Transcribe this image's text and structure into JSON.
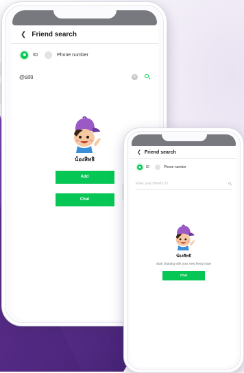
{
  "big_phone": {
    "header_title": "Friend search",
    "radio_id_label": "ID",
    "radio_phone_label": "Phone number",
    "search_value": "@sitti",
    "profile_name": "น้องสิทธิ",
    "add_label": "Add",
    "chat_label": "Chat"
  },
  "small_phone": {
    "header_title": "Friend search",
    "radio_id_label": "ID",
    "radio_phone_label": "Phone number",
    "search_placeholder": "Enter your friend's ID",
    "profile_name": "น้องสิทธิ",
    "subtitle": "Start chatting with your new friend now!",
    "chat_label": "Chat"
  },
  "icons": {
    "back": "chevron-left-icon",
    "clear": "clear-icon",
    "search": "search-icon"
  },
  "colors": {
    "accent": "#06c755",
    "background_purple": "#5a2b8e",
    "notch": "#77797f"
  }
}
